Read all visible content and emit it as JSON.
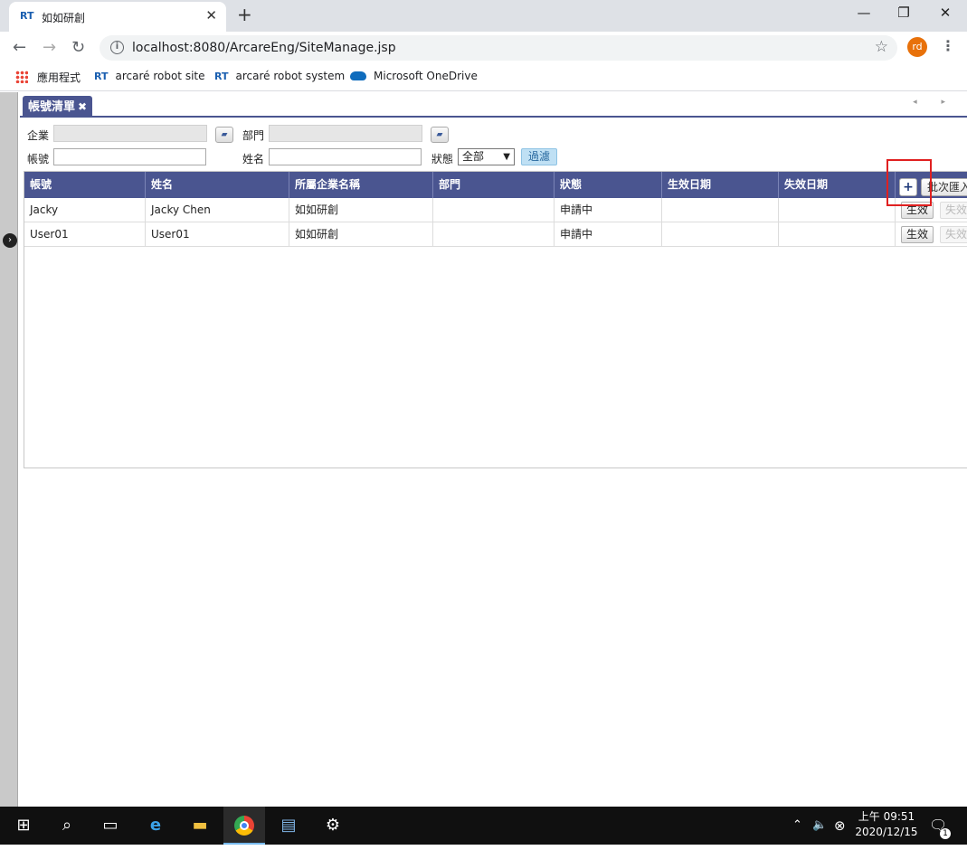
{
  "browser": {
    "tab_favicon": "RT",
    "tab_title": "如如研創",
    "tab_close": "✕",
    "new_tab": "+",
    "window_controls": {
      "minimize": "—",
      "restore": "❐",
      "close": "✕"
    },
    "nav": {
      "back": "←",
      "forward": "→",
      "reload": "↻"
    },
    "info_glyph": "i",
    "url": "localhost:8080/ArcareEng/SiteManage.jsp",
    "star": "☆",
    "avatar_initials": "rd",
    "menu": "⋮",
    "bookmarks": [
      {
        "icon": "apps-grid-icon",
        "label": "應用程式"
      },
      {
        "icon": "RT",
        "label": "arcaré robot site"
      },
      {
        "icon": "RT",
        "label": "arcaré robot system"
      },
      {
        "icon": "onedrive-cloud-icon",
        "label": "Microsoft OneDrive"
      }
    ]
  },
  "panel": {
    "tab_label": "帳號清單",
    "tab_close": "✖",
    "arrows": "◂ ▸"
  },
  "filters": {
    "enterprise_label": "企業",
    "department_label": "部門",
    "account_label": "帳號",
    "name_label": "姓名",
    "status_label": "狀態",
    "status_value": "全部",
    "filter_button": "過濾",
    "folder_glyph": "📂"
  },
  "grid": {
    "columns": [
      "帳號",
      "姓名",
      "所屬企業名稱",
      "部門",
      "狀態",
      "生效日期",
      "失效日期"
    ],
    "add_button": "+",
    "batch_button": "批次匯入",
    "rows": [
      {
        "account": "Jacky",
        "name": "Jacky Chen",
        "enterprise": "如如研創",
        "department": "",
        "status": "申請中",
        "effective": "",
        "expiry": "",
        "activate": "生效",
        "deactivate": "失效"
      },
      {
        "account": "User01",
        "name": "User01",
        "enterprise": "如如研創",
        "department": "",
        "status": "申請中",
        "effective": "",
        "expiry": "",
        "activate": "生效",
        "deactivate": "失效"
      }
    ]
  },
  "taskbar": {
    "clock_time": "上午 09:51",
    "clock_date": "2020/12/15",
    "notification_count": "1"
  },
  "colors": {
    "header_bg": "#4a5590",
    "highlight": "#e02020",
    "taskbar_bg": "#101010"
  }
}
